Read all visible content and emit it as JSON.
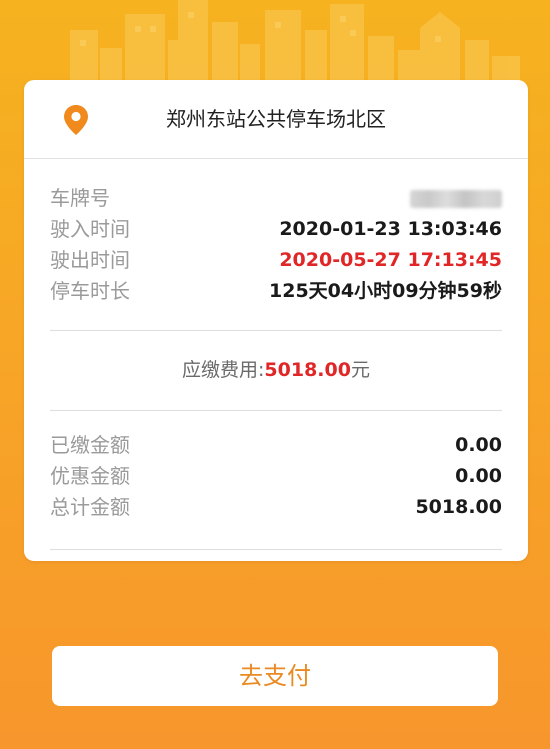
{
  "lot": {
    "name": "郑州东站公共停车场北区"
  },
  "details": {
    "plate_label": "车牌号",
    "entry_label": "驶入时间",
    "entry_value": "2020-01-23 13:03:46",
    "exit_label": "驶出时间",
    "exit_value": "2020-05-27 17:13:45",
    "duration_label": "停车时长",
    "duration_value": "125天04小时09分钟59秒"
  },
  "fee": {
    "label": "应缴费用:",
    "amount": "5018.00",
    "unit": "元"
  },
  "summary": {
    "paid_label": "已缴金额",
    "paid_value": "0.00",
    "discount_label": "优惠金额",
    "discount_value": "0.00",
    "total_label": "总计金额",
    "total_value": "5018.00"
  },
  "actions": {
    "pay_label": "去支付"
  },
  "colors": {
    "accent_orange": "#f7a626",
    "alert_red": "#e02626",
    "pay_text": "#ea8a22"
  },
  "icons": {
    "location": "map-pin-icon"
  }
}
